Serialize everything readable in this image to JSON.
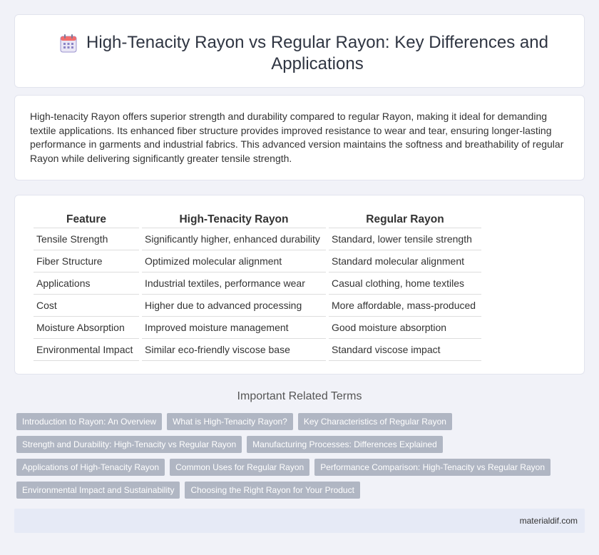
{
  "header": {
    "icon": "calendar-icon",
    "title": "High-Tenacity Rayon vs Regular Rayon: Key Differences and Applications"
  },
  "summary": "High-tenacity Rayon offers superior strength and durability compared to regular Rayon, making it ideal for demanding textile applications. Its enhanced fiber structure provides improved resistance to wear and tear, ensuring longer-lasting performance in garments and industrial fabrics. This advanced version maintains the softness and breathability of regular Rayon while delivering significantly greater tensile strength.",
  "table": {
    "headers": [
      "Feature",
      "High-Tenacity Rayon",
      "Regular Rayon"
    ],
    "rows": [
      [
        "Tensile Strength",
        "Significantly higher, enhanced durability",
        "Standard, lower tensile strength"
      ],
      [
        "Fiber Structure",
        "Optimized molecular alignment",
        "Standard molecular alignment"
      ],
      [
        "Applications",
        "Industrial textiles, performance wear",
        "Casual clothing, home textiles"
      ],
      [
        "Cost",
        "Higher due to advanced processing",
        "More affordable, mass-produced"
      ],
      [
        "Moisture Absorption",
        "Improved moisture management",
        "Good moisture absorption"
      ],
      [
        "Environmental Impact",
        "Similar eco-friendly viscose base",
        "Standard viscose impact"
      ]
    ]
  },
  "related": {
    "title": "Important Related Terms",
    "rows": [
      [
        "Introduction to Rayon: An Overview",
        "What is High-Tenacity Rayon?",
        "Key Characteristics of Regular Rayon"
      ],
      [
        "Strength and Durability: High-Tenacity vs Regular Rayon",
        "Manufacturing Processes: Differences Explained"
      ],
      [
        "Applications of High-Tenacity Rayon",
        "Common Uses for Regular Rayon",
        "Performance Comparison: High-Tenacity vs Regular Rayon"
      ],
      [
        "Environmental Impact and Sustainability",
        "Choosing the Right Rayon for Your Product"
      ]
    ]
  },
  "footer": {
    "site": "materialdif.com"
  }
}
